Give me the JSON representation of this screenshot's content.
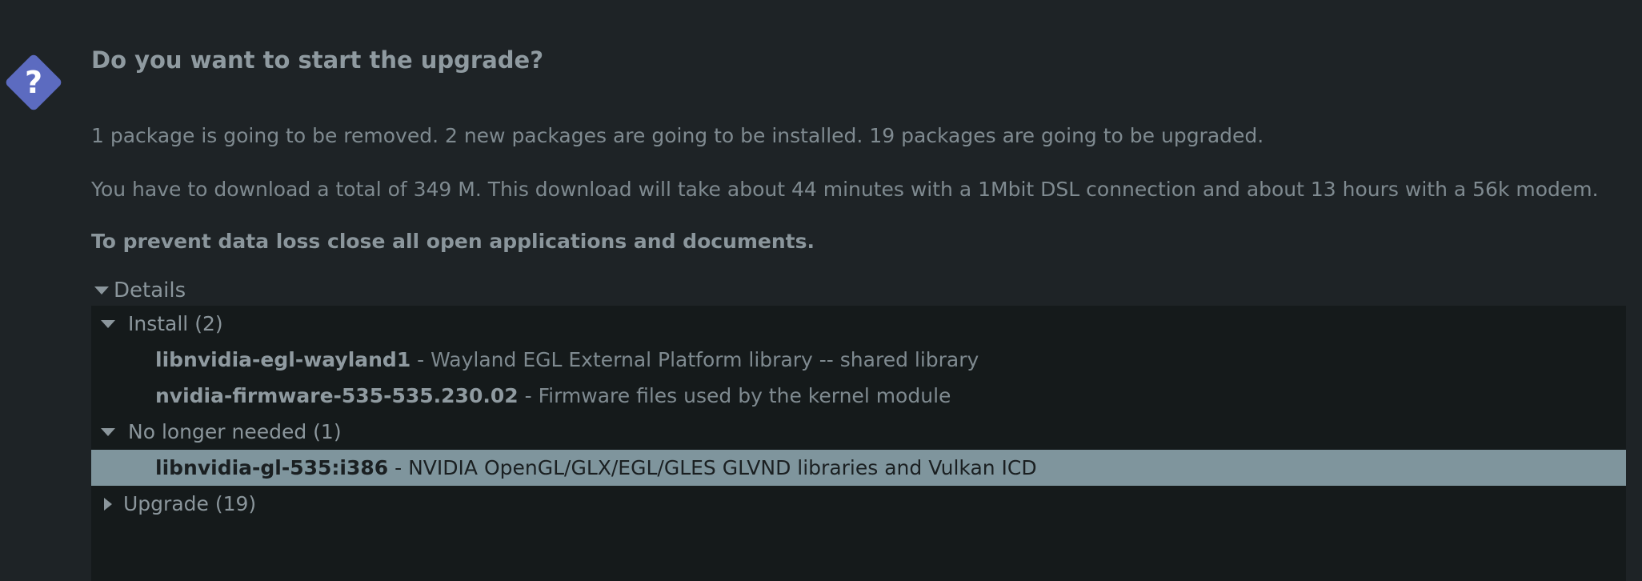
{
  "dialog": {
    "heading": "Do you want to start the upgrade?",
    "summary": "1 package is going to be removed. 2 new packages are going to be installed. 19 packages are going to be upgraded.",
    "download_info": "You have to download a total of 349 M. This download will take about 44 minutes with a 1Mbit DSL connection and about 13 hours with a 56k modem.",
    "warning": "To prevent data loss close all open applications and documents.",
    "icon": "question-icon",
    "icon_color": "#5c6bc0"
  },
  "details": {
    "label": "Details",
    "expanded": true,
    "groups": [
      {
        "label": "Install (2)",
        "expanded": true,
        "items": [
          {
            "name": "libnvidia-egl-wayland1",
            "sep": " - ",
            "description": "Wayland EGL External Platform library -- shared library"
          },
          {
            "name": "nvidia-firmware-535-535.230.02",
            "sep": " - ",
            "description": "Firmware files used by the kernel module"
          }
        ]
      },
      {
        "label": "No longer needed (1)",
        "expanded": true,
        "items": [
          {
            "name": "libnvidia-gl-535:i386",
            "sep": " - ",
            "description": "NVIDIA OpenGL/GLX/EGL/GLES GLVND libraries and Vulkan ICD",
            "selected": true
          }
        ]
      },
      {
        "label": "Upgrade (19)",
        "expanded": false,
        "items": []
      }
    ]
  },
  "colors": {
    "background": "#1e2326",
    "tree_background": "#151a1b",
    "selection": "#7f959d"
  }
}
